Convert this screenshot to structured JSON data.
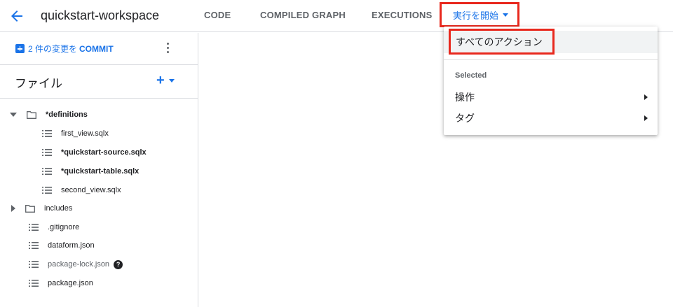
{
  "header": {
    "back_icon": "arrow-back-icon",
    "workspace_title": "quickstart-workspace",
    "tabs": [
      {
        "label": "CODE"
      },
      {
        "label": "COMPILED GRAPH"
      },
      {
        "label": "EXECUTIONS"
      }
    ],
    "run_button_label": "実行を開始"
  },
  "sidebar": {
    "commit_count_text": "2 件の変更を",
    "commit_word": "COMMIT",
    "files_title": "ファイル",
    "add_label": "+",
    "tree": [
      {
        "label": "*definitions",
        "type": "folder",
        "expanded": true
      },
      {
        "label": "first_view.sqlx",
        "type": "file"
      },
      {
        "label": "*quickstart-source.sqlx",
        "type": "file"
      },
      {
        "label": "*quickstart-table.sqlx",
        "type": "file"
      },
      {
        "label": "second_view.sqlx",
        "type": "file"
      },
      {
        "label": "includes",
        "type": "folder",
        "expanded": false
      },
      {
        "label": ".gitignore",
        "type": "file"
      },
      {
        "label": "dataform.json",
        "type": "file"
      },
      {
        "label": "package-lock.json",
        "type": "file"
      },
      {
        "label": "package.json",
        "type": "file"
      }
    ],
    "help_glyph": "?"
  },
  "run_menu": {
    "all_actions": "すべてのアクション",
    "section_label": "Selected",
    "items": [
      {
        "label": "操作"
      },
      {
        "label": "タグ"
      }
    ]
  },
  "colors": {
    "accent": "#1a73e8",
    "highlight_box": "#e8281d",
    "text_primary": "#202124",
    "text_secondary": "#5f6368"
  }
}
